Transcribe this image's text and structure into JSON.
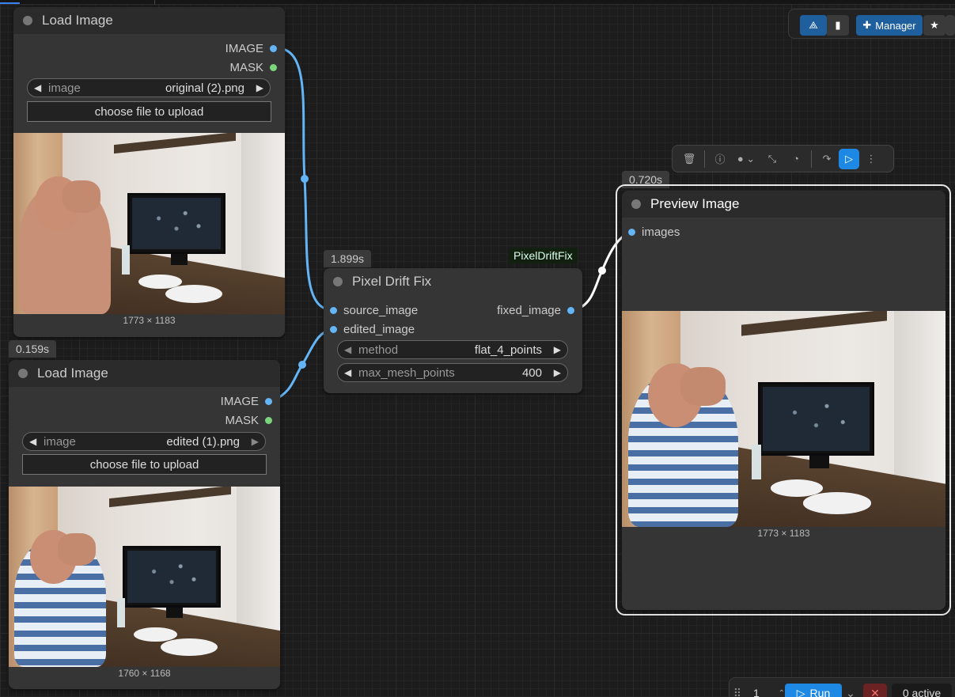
{
  "nodes": {
    "load_image_1": {
      "title": "Load Image",
      "outputs": [
        "IMAGE",
        "MASK"
      ],
      "widget_name": "image",
      "widget_value": "original (2).png",
      "upload_label": "choose file to upload",
      "dimensions": "1773 × 1183"
    },
    "load_image_2": {
      "timer": "0.159s",
      "title": "Load Image",
      "outputs": [
        "IMAGE",
        "MASK"
      ],
      "widget_name": "image",
      "widget_value": "edited (1).png",
      "upload_label": "choose file to upload",
      "dimensions": "1760 × 1168"
    },
    "pixel_drift_fix": {
      "timer": "1.899s",
      "badge": "PixelDriftFix",
      "title": "Pixel Drift Fix",
      "inputs": [
        "source_image",
        "edited_image"
      ],
      "output": "fixed_image",
      "widgets": [
        {
          "name": "method",
          "value": "flat_4_points"
        },
        {
          "name": "max_mesh_points",
          "value": "400"
        }
      ]
    },
    "preview_image": {
      "timer": "0.720s",
      "title": "Preview Image",
      "input": "images",
      "dimensions": "1773 × 1183"
    }
  },
  "menubar": {
    "manager_label": "Manager"
  },
  "bottombar": {
    "batch_count": "1",
    "run_label": "Run",
    "active_label": "0 active"
  },
  "colors": {
    "accent": "#1e88e5",
    "image_slot": "#64b5f6",
    "mask_slot": "#7bd67b",
    "link": "#64b5f6",
    "link_selected": "#ffffff"
  }
}
